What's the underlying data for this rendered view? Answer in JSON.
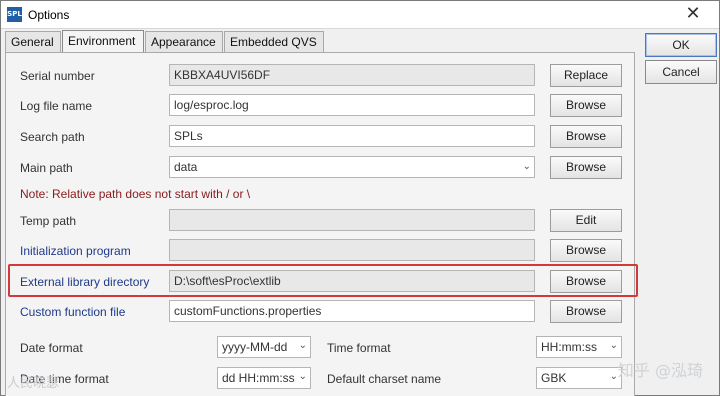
{
  "window": {
    "title": "Options",
    "app_icon_text": "SPL"
  },
  "tabs": [
    "General",
    "Environment",
    "Appearance",
    "Embedded QVS"
  ],
  "actions": {
    "ok": "OK",
    "cancel": "Cancel"
  },
  "rows": {
    "serial_number": {
      "label": "Serial number",
      "value": "KBBXA4UVI56DF",
      "button": "Replace"
    },
    "log_file_name": {
      "label": "Log file name",
      "value": "log/esproc.log",
      "button": "Browse"
    },
    "search_path": {
      "label": "Search path",
      "value": "SPLs",
      "button": "Browse"
    },
    "main_path": {
      "label": "Main path",
      "value": "data",
      "button": "Browse"
    },
    "note": "Note: Relative path does not start with / or \\",
    "temp_path": {
      "label": "Temp path",
      "value": "",
      "button": "Edit"
    },
    "init_program": {
      "label": "Initialization program",
      "value": "",
      "button": "Browse"
    },
    "ext_lib_dir": {
      "label": "External library directory",
      "value": "D:\\soft\\esProc\\extlib",
      "button": "Browse"
    },
    "custom_func_file": {
      "label": "Custom function file",
      "value": "customFunctions.properties",
      "button": "Browse"
    }
  },
  "formats": {
    "date_format": {
      "label": "Date format",
      "value": "yyyy-MM-dd"
    },
    "time_format": {
      "label": "Time format",
      "value": "HH:mm:ss"
    },
    "datetime_format": {
      "label": "Date time format",
      "value": "dd HH:mm:ss"
    },
    "charset": {
      "label": "Default charset name",
      "value": "GBK"
    }
  },
  "watermark": {
    "right": "知乎 @泓琦",
    "left": "人民晓瑟"
  },
  "colors": {
    "highlight": "#d23a3a",
    "note": "#8b1a1a",
    "blue_label": "#1e3a8a"
  },
  "icons": {
    "close": "close-icon",
    "dropdown": "chevron-down-icon"
  }
}
